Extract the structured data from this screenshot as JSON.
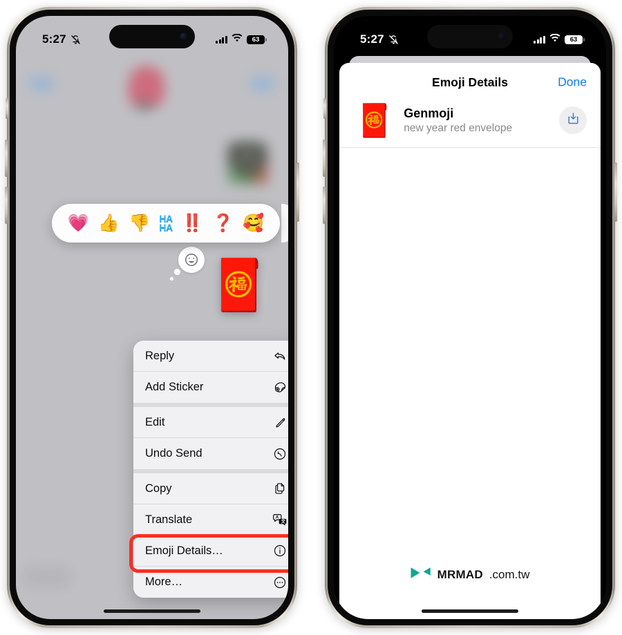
{
  "left_phone": {
    "status_bar": {
      "time": "5:27",
      "mute_icon": "bell-slash-icon",
      "signal_icon": "cellular-bars-icon",
      "wifi_icon": "wifi-icon",
      "battery_level": "63"
    },
    "reactions": [
      {
        "name": "heart",
        "glyph": "💗"
      },
      {
        "name": "thumbs-up",
        "glyph": "👍"
      },
      {
        "name": "thumbs-down",
        "glyph": "👎"
      },
      {
        "name": "haha",
        "line1": "HA",
        "line2": "HA"
      },
      {
        "name": "double-exclamation",
        "glyph": "‼️"
      },
      {
        "name": "question-mark",
        "glyph": "❓"
      },
      {
        "name": "smiley-hearts",
        "glyph": "🥰"
      }
    ],
    "message": {
      "genmoji": "🧧",
      "thought_icon": "smiley-face-icon"
    },
    "context_menu": {
      "groups": [
        {
          "items": [
            {
              "label": "Reply",
              "icon": "reply-arrow-icon"
            },
            {
              "label": "Add Sticker",
              "icon": "add-sticker-icon"
            }
          ]
        },
        {
          "items": [
            {
              "label": "Edit",
              "icon": "pencil-icon"
            },
            {
              "label": "Undo Send",
              "icon": "undo-arrow-icon"
            }
          ]
        },
        {
          "items": [
            {
              "label": "Copy",
              "icon": "copy-pages-icon"
            },
            {
              "label": "Translate",
              "icon": "translate-icon"
            },
            {
              "label": "Emoji Details…",
              "icon": "info-circle-icon"
            },
            {
              "label": "More…",
              "icon": "ellipsis-circle-icon"
            }
          ]
        }
      ],
      "highlighted_item": "Emoji Details…",
      "highlight_color": "#fb2e23"
    }
  },
  "right_phone": {
    "status_bar": {
      "time": "5:27",
      "mute_icon": "bell-slash-icon",
      "signal_icon": "cellular-bars-icon",
      "wifi_icon": "wifi-icon",
      "battery_level": "63"
    },
    "sheet": {
      "title": "Emoji Details",
      "done_label": "Done",
      "detail": {
        "emoji": "🧧",
        "title": "Genmoji",
        "subtitle": "new year red envelope",
        "action_icon": "download-icon",
        "action_color": "#3b7fd4"
      }
    },
    "watermark": {
      "logo_icon": "mrmad-bowtie-logo",
      "logo_color": "#11a595",
      "name": "MRMAD",
      "tld": ".com.tw"
    }
  },
  "accent_colors": {
    "ios_blue": "#0a7cff",
    "highlight_red": "#fb2e23",
    "haha_blue": "#36b5f0"
  }
}
